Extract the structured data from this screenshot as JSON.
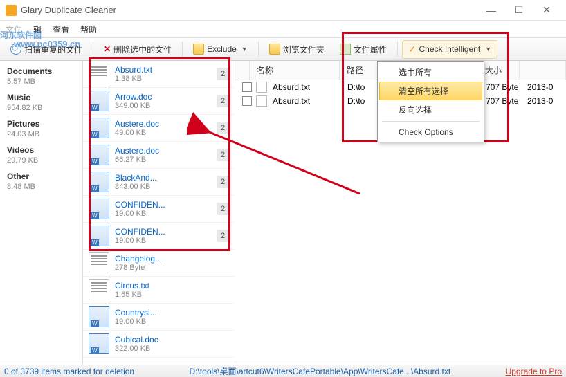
{
  "window": {
    "title": "Glary Duplicate Cleaner"
  },
  "watermark": {
    "main": "河东软件园",
    "sub": "www.pc0359.cn"
  },
  "menu": {
    "file": "文件",
    "edit": "辑",
    "view": "查看",
    "help": "帮助"
  },
  "toolbar": {
    "scan": "扫描重复的文件",
    "delete": "删除选中的文件",
    "exclude": "Exclude",
    "browse": "浏览文件夹",
    "props": "文件属性",
    "check": "Check Intelligent"
  },
  "sidebar": [
    {
      "name": "Documents",
      "size": "5.57 MB"
    },
    {
      "name": "Music",
      "size": "954.82 KB"
    },
    {
      "name": "Pictures",
      "size": "24.03 MB"
    },
    {
      "name": "Videos",
      "size": "29.79 KB"
    },
    {
      "name": "Other",
      "size": "8.48 MB"
    }
  ],
  "files": [
    {
      "name": "Absurd.txt",
      "size": "1.38 KB",
      "type": "txt",
      "count": "2"
    },
    {
      "name": "Arrow.doc",
      "size": "349.00 KB",
      "type": "doc",
      "count": "2"
    },
    {
      "name": "Austere.doc",
      "size": "49.00 KB",
      "type": "doc",
      "count": "2"
    },
    {
      "name": "Austere.doc",
      "size": "66.27 KB",
      "type": "doc",
      "count": "2"
    },
    {
      "name": "BlackAnd...",
      "size": "343.00 KB",
      "type": "doc",
      "count": "2"
    },
    {
      "name": "CONFIDEN...",
      "size": "19.00 KB",
      "type": "doc",
      "count": "2"
    },
    {
      "name": "CONFIDEN...",
      "size": "19.00 KB",
      "type": "doc",
      "count": "2"
    },
    {
      "name": "Changelog...",
      "size": "278 Byte",
      "type": "txt",
      "count": ""
    },
    {
      "name": "Circus.txt",
      "size": "1.65 KB",
      "type": "txt",
      "count": ""
    },
    {
      "name": "Countrysi...",
      "size": "19.00 KB",
      "type": "doc",
      "count": ""
    },
    {
      "name": "Cubical.doc",
      "size": "322.00 KB",
      "type": "doc",
      "count": ""
    }
  ],
  "detail": {
    "cols": {
      "name": "名称",
      "path": "路径",
      "size": "大小"
    },
    "rows": [
      {
        "name": "Absurd.txt",
        "path": "D:\\to",
        "size": "707 Byte",
        "date": "2013-0"
      },
      {
        "name": "Absurd.txt",
        "path": "D:\\to",
        "size": "707 Byte",
        "date": "2013-0"
      }
    ]
  },
  "popup": {
    "select_all": "选中所有",
    "clear_all": "清空所有选择",
    "invert": "反向选择",
    "options": "Check Options"
  },
  "status": {
    "marked": "0 of 3739 items marked for deletion",
    "path": "D:\\tools\\桌面\\artcut6\\WritersCafePortable\\App\\WritersCafe...\\Absurd.txt",
    "upgrade": "Upgrade to Pro"
  }
}
